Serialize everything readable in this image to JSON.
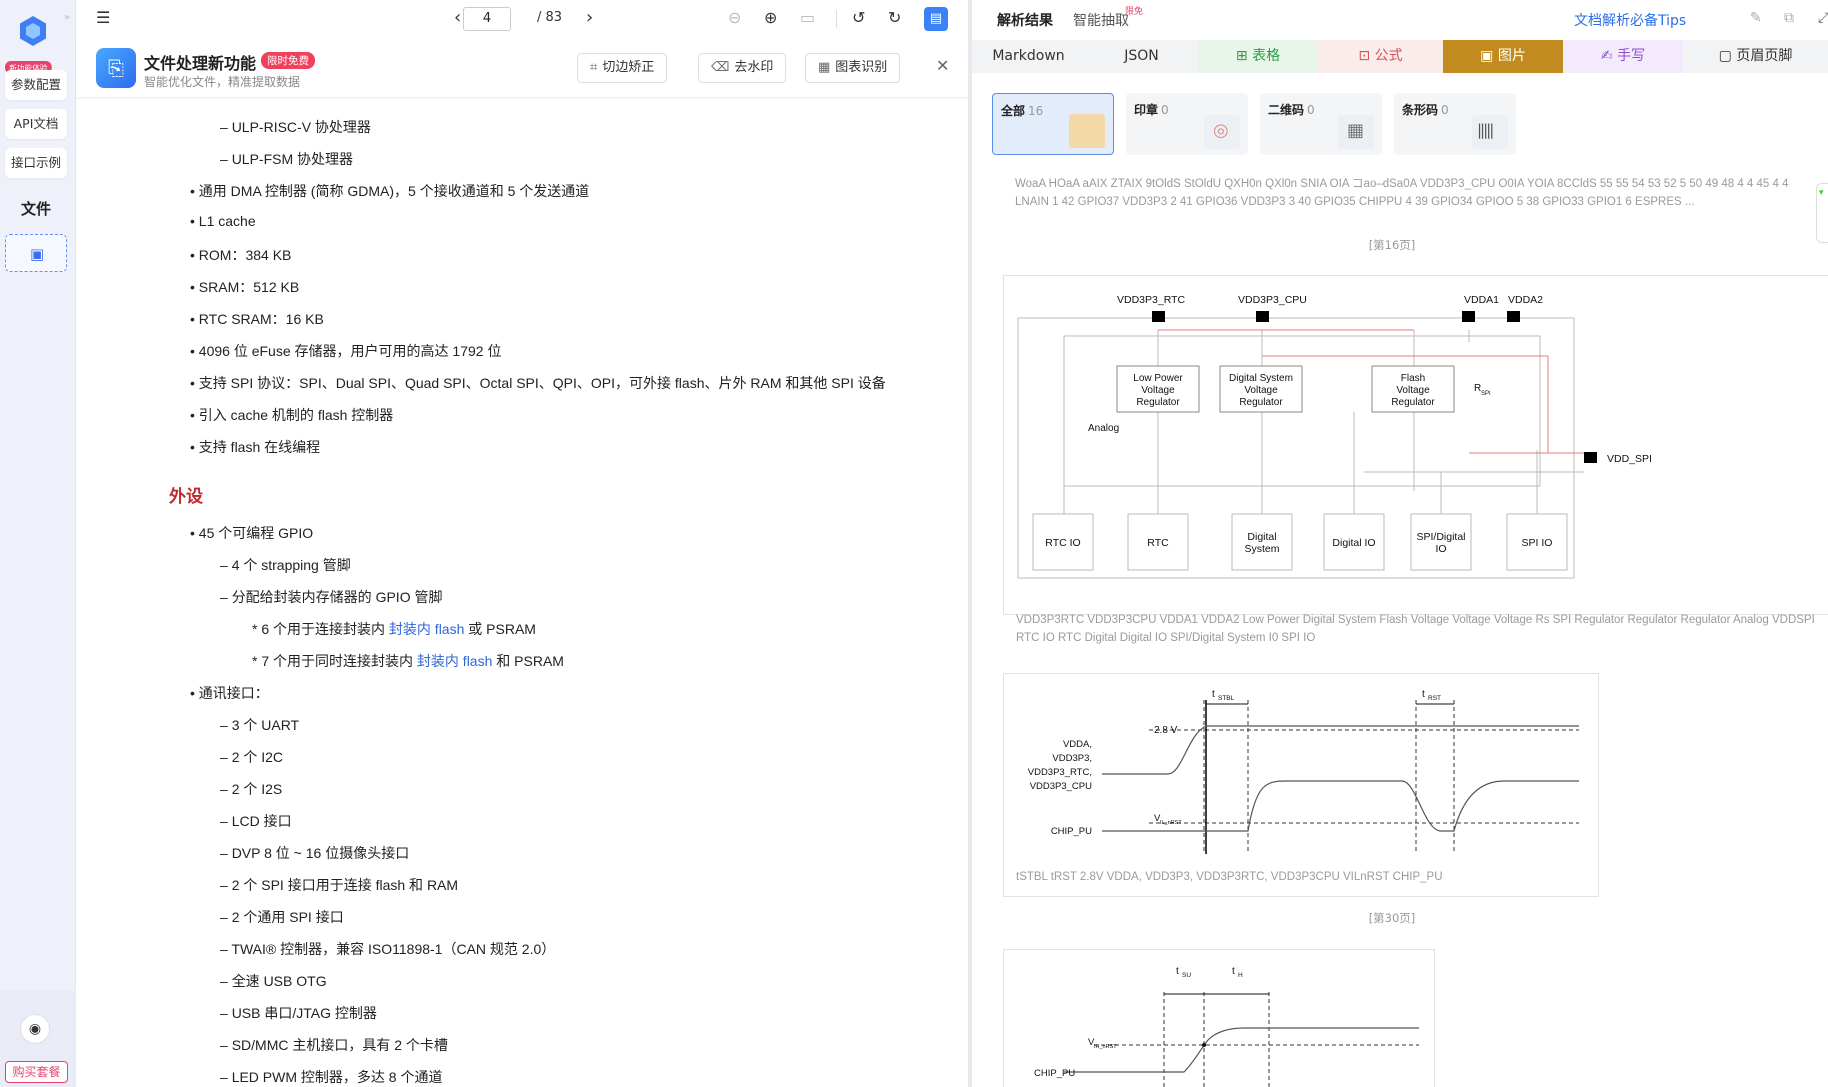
{
  "rail": {
    "badge": "新功能体验",
    "buttons": [
      "参数配置",
      "API文档",
      "接口示例"
    ],
    "file_label": "文件",
    "buy_label": "购买套餐"
  },
  "viewer": {
    "page_current": "4",
    "page_total": "/ 83",
    "banner": {
      "title": "文件处理新功能",
      "tag": "限时免费",
      "subtitle": "智能优化文件，精准提取数据",
      "btn_crop": "切边矫正",
      "btn_watermark": "去水印",
      "btn_chart": "图表识别"
    },
    "lines": [
      "ULP-RISC-V 协处理器",
      "ULP-FSM 协处理器",
      "通用 DMA 控制器 (简称 GDMA)，5 个接收通道和 5 个发送通道",
      "L1 cache",
      "ROM：384 KB",
      "SRAM：512 KB",
      "RTC SRAM：16 KB",
      "4096 位 eFuse 存储器，用户可用的高达 1792 位",
      "支持 SPI 协议：SPI、Dual SPI、Quad SPI、Octal SPI、QPI、OPI，可外接 flash、片外 RAM 和其他 SPI 设备",
      "引入 cache 机制的 flash 控制器",
      "支持 flash 在线编程",
      "外设",
      "45 个可编程 GPIO",
      "4 个 strapping 管脚",
      "分配给封装内存储器的 GPIO 管脚",
      "6 个用于连接封装内",
      "封装内 flash",
      "或 PSRAM",
      "7 个用于同时连接封装内",
      "封装内 flash",
      "和 PSRAM",
      "通讯接口：",
      "3 个 UART",
      "2 个 I2C",
      "2 个 I2S",
      "LCD 接口",
      "DVP 8 位 ~ 16 位摄像头接口",
      "2 个 SPI 接口用于连接 flash 和 RAM",
      "2 个通用 SPI 接口",
      "TWAI® 控制器，兼容 ISO11898-1（CAN 规范 2.0）",
      "全速 USB OTG",
      "USB 串口/JTAG 控制器",
      "SD/MMC 主机接口，具有 2 个卡槽",
      "LED PWM 控制器，多达 8 个通道"
    ]
  },
  "right": {
    "tab_result": "解析结果",
    "tab_extract": "智能抽取",
    "tab_hot": "限免",
    "tips": "文档解析必备Tips",
    "formats": [
      "Markdown",
      "JSON",
      "表格",
      "公式",
      "图片",
      "手写",
      "页眉页脚"
    ],
    "chips": [
      {
        "label": "全部",
        "count": "16"
      },
      {
        "label": "印章",
        "count": "0"
      },
      {
        "label": "二维码",
        "count": "0"
      },
      {
        "label": "条形码",
        "count": "0"
      }
    ],
    "ocr1": "WoaA HOaA aAIX ZTAIX 9tOldS StOldU QXH0n QXl0n SNIA OIA コao–dSa0A VDD3P3_CPU O0IA YOIA 8CCldS 55 55 54 53 52 5 50 49 48 4 4 45 4 4 LNAIN 1 42 GPIO37 VDD3P3 2 41 GPIO36 VDD3P3 3 40 GPIO35 CHIPPU 4 39 GPIO34 GPIOO 5 38 GPIO33 GPIO1 6 ESPRES ...",
    "page16": "[第16页]",
    "fig1": {
      "pins": [
        "VDD3P3_RTC",
        "VDD3P3_CPU",
        "VDDA1",
        "VDDA2",
        "VDD_SPI"
      ],
      "regs": [
        [
          "Low Power",
          "Voltage",
          "Regulator"
        ],
        [
          "Digital System",
          "Voltage",
          "Regulator"
        ],
        [
          "Flash",
          "Voltage",
          "Regulator"
        ]
      ],
      "rspi": "R",
      "rspi_sub": "SPI",
      "analog": "Analog",
      "ios": [
        [
          "RTC IO"
        ],
        [
          "RTC"
        ],
        [
          "Digital",
          "System"
        ],
        [
          "Digital IO"
        ],
        [
          "SPI/Digital",
          "IO"
        ],
        [
          "SPI IO"
        ]
      ]
    },
    "ocr2": "VDD3P3RTC VDD3P3CPU VDDA1 VDDA2 Low Power Digital System Flash Voltage Voltage Voltage Rs SPI Regulator Regulator Regulator Analog VDDSPI RTC IO RTC Digital Digital IO SPI/Digital System I0 SPI IO",
    "fig2": {
      "t1": "t",
      "t1_sub": "STBL",
      "t2": "t",
      "t2_sub": "RST",
      "v28": "2.8 V",
      "vdda": [
        "VDDA,",
        "VDD3P3,",
        "VDD3P3_RTC,",
        "VDD3P3_CPU"
      ],
      "vil": "V",
      "vil_sub": "IL_nRST",
      "chip": "CHIP_PU"
    },
    "ocr3": "tSTBL tRST 2.8V VDDA, VDD3P3, VDD3P3RTC, VDD3P3CPU VILnRST CHIP_PU",
    "page30": "[第30页]",
    "fig3": {
      "tsu": "t",
      "tsu_sub": "SU",
      "th": "t",
      "th_sub": "H",
      "vih": "V",
      "vih_sub": "IH_nRST",
      "chip": "CHIP_PU"
    }
  }
}
